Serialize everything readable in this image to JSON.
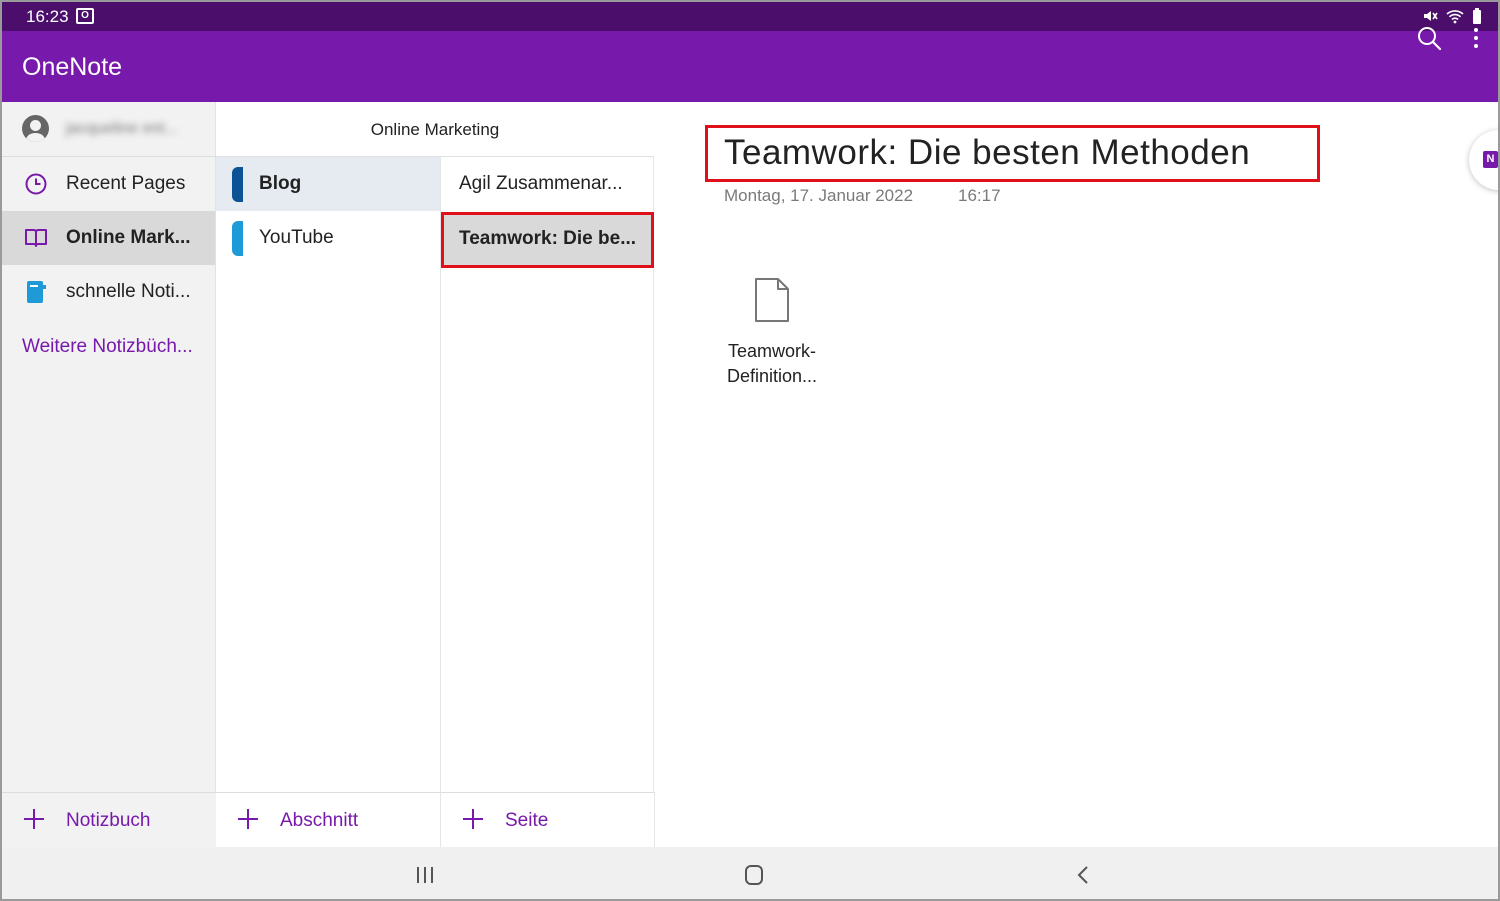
{
  "status_bar": {
    "time": "16:23",
    "notification_icon": "outlook-icon",
    "icons": [
      "mute-icon",
      "wifi-icon",
      "battery-icon"
    ]
  },
  "app_bar": {
    "title": "OneNote",
    "actions": [
      "search-icon",
      "more-vertical-icon"
    ]
  },
  "notebooks_panel": {
    "account_name": "jacqueline ent...",
    "items": [
      {
        "label": "Recent Pages",
        "icon": "clock-icon",
        "active": false
      },
      {
        "label": "Online Mark...",
        "icon": "notebook-open-icon",
        "active": true
      },
      {
        "label": "schnelle Noti...",
        "icon": "notebook-icon",
        "active": false
      }
    ],
    "more_link": "Weitere Notizbüch...",
    "add_label": "Notizbuch"
  },
  "sections_panel": {
    "header": "Online Marketing",
    "items": [
      {
        "label": "Blog",
        "color": "#0b5394",
        "active": true
      },
      {
        "label": "YouTube",
        "color": "#1e9bd7",
        "active": false
      }
    ],
    "add_label": "Abschnitt"
  },
  "pages_panel": {
    "items": [
      {
        "label": "Agil Zusammenar...",
        "active": false
      },
      {
        "label": "Teamwork: Die be...",
        "active": true
      }
    ],
    "add_label": "Seite"
  },
  "page": {
    "title": "Teamwork: Die besten Methoden",
    "date": "Montag, 17. Januar 2022",
    "time": "16:17",
    "attachment": {
      "icon": "document-icon",
      "name": "Teamwork-Definition..."
    }
  },
  "colors": {
    "accent": "#7719aa",
    "status_bar": "#4b0f6b",
    "highlight": "#e0101a"
  },
  "nav_bar": {
    "buttons": [
      "recent-apps-icon",
      "home-icon",
      "back-icon"
    ]
  }
}
